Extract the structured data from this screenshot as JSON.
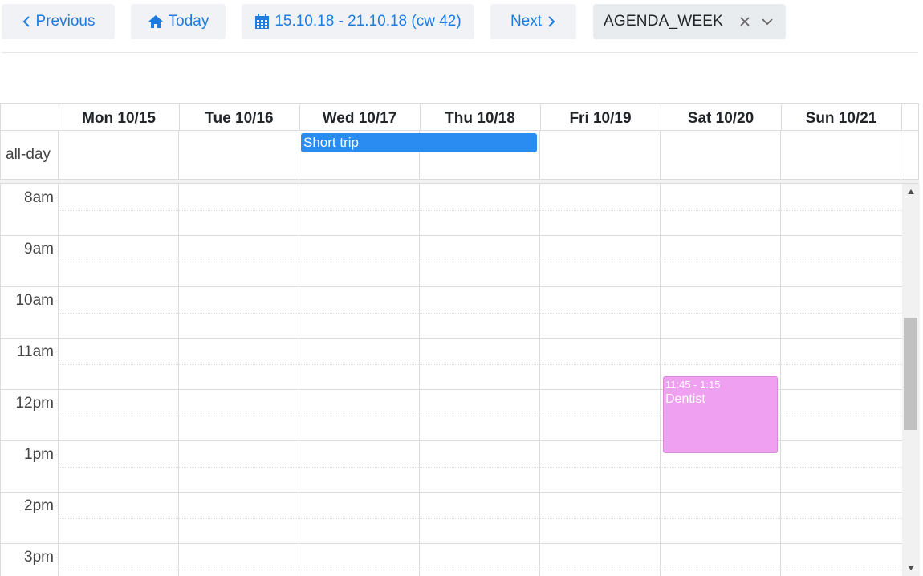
{
  "toolbar": {
    "previous_label": "Previous",
    "today_label": "Today",
    "range_label": "15.10.18 - 21.10.18 (cw 42)",
    "next_label": "Next",
    "view_select": {
      "value": "AGENDA_WEEK"
    }
  },
  "calendar": {
    "days": [
      {
        "label": "Mon 10/15"
      },
      {
        "label": "Tue 10/16"
      },
      {
        "label": "Wed 10/17"
      },
      {
        "label": "Thu 10/18"
      },
      {
        "label": "Fri 10/19"
      },
      {
        "label": "Sat 10/20"
      },
      {
        "label": "Sun 10/21"
      }
    ],
    "allday_label": "all-day",
    "allday_events": [
      {
        "title": "Short trip",
        "start_day": "Wed 10/17",
        "end_day": "Thu 10/18",
        "color": "#2a8cf0"
      }
    ],
    "time_labels": [
      "8am",
      "9am",
      "10am",
      "11am",
      "12pm",
      "1pm",
      "2pm",
      "3pm"
    ],
    "events": [
      {
        "time": "11:45 - 1:15",
        "title": "Dentist",
        "day": "Sat 10/20",
        "color": "#f0a0f0"
      }
    ]
  },
  "colors": {
    "accent": "#1e7be0",
    "button_bg": "#f0f2f5",
    "select_bg": "#e9ecef",
    "grid": "#dcdcdc"
  },
  "icons": {
    "previous": "chevron-left-icon",
    "today": "home-icon",
    "range": "calendar-icon",
    "next": "chevron-right-icon",
    "clear": "close-icon",
    "dropdown": "chevron-down-icon"
  }
}
